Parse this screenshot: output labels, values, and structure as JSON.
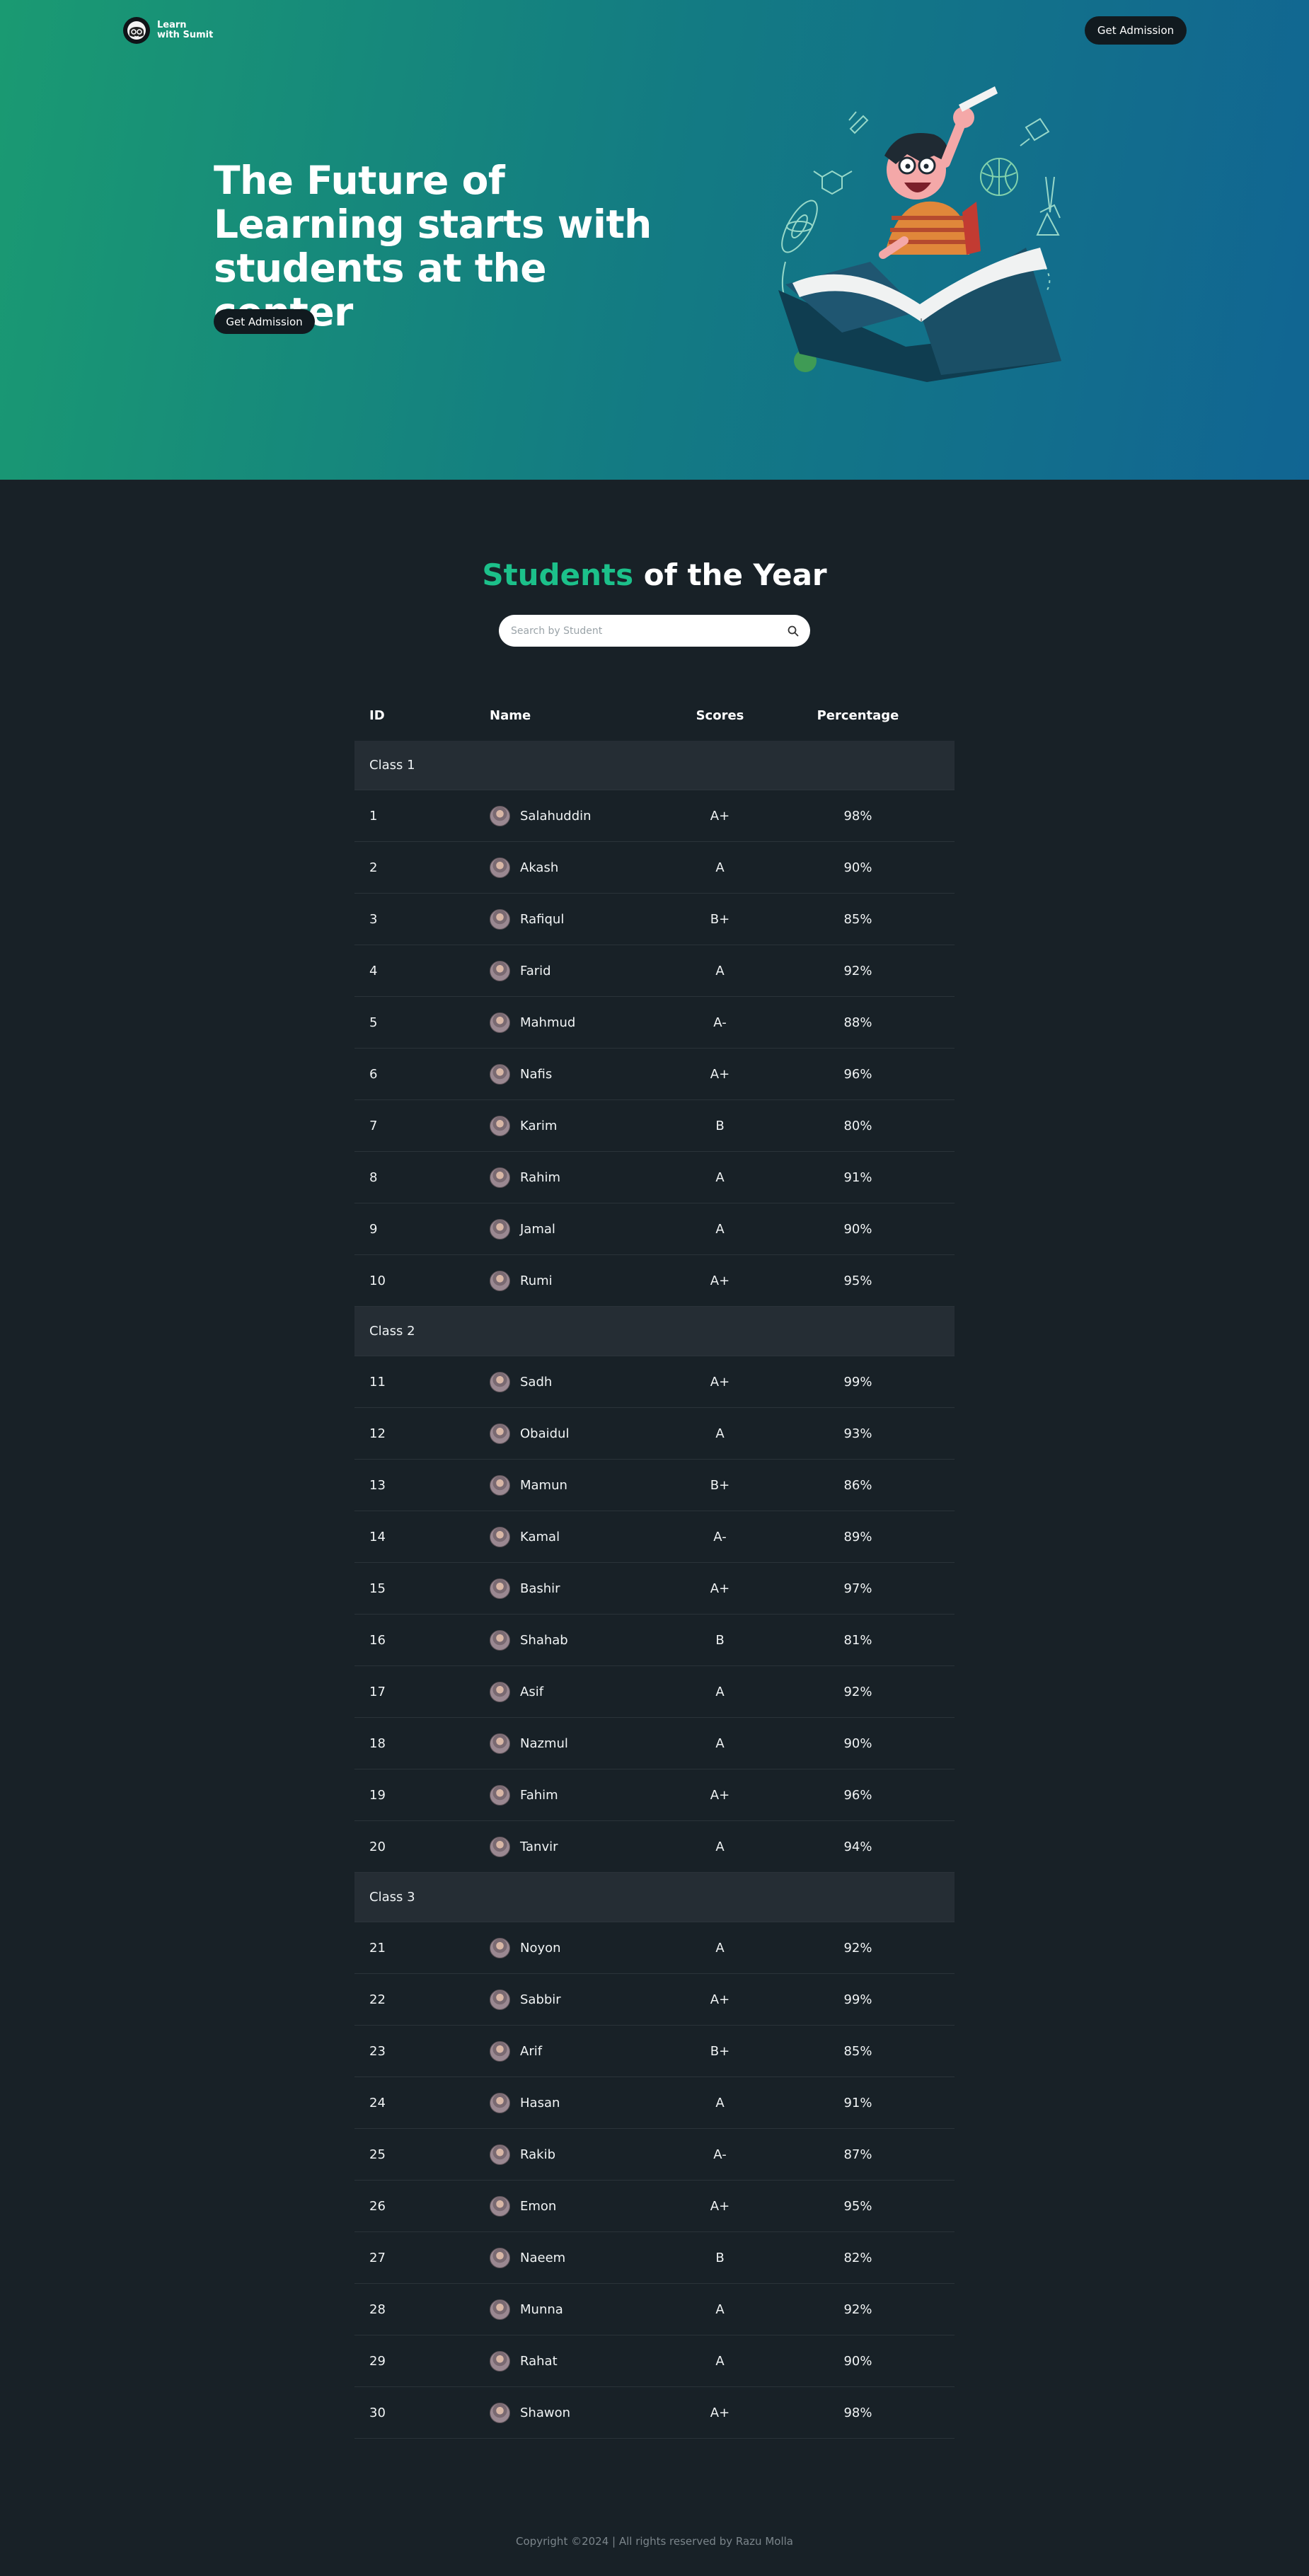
{
  "brand": {
    "line1": "Learn",
    "line2": "with Sumit"
  },
  "nav": {
    "cta_label": "Get Admission"
  },
  "hero": {
    "title": "The Future of Learning starts with students at the center",
    "cta_label": "Get Admission"
  },
  "section": {
    "title_accent": "Students",
    "title_rest": " of the Year"
  },
  "search": {
    "placeholder": "Search by Student",
    "value": ""
  },
  "table": {
    "headers": {
      "id": "ID",
      "name": "Name",
      "scores": "Scores",
      "percentage": "Percentage"
    },
    "groups": [
      {
        "label": "Class 1",
        "rows": [
          {
            "id": "1",
            "name": "Salahuddin",
            "score": "A+",
            "percentage": "98%"
          },
          {
            "id": "2",
            "name": "Akash",
            "score": "A",
            "percentage": "90%"
          },
          {
            "id": "3",
            "name": "Rafiqul",
            "score": "B+",
            "percentage": "85%"
          },
          {
            "id": "4",
            "name": "Farid",
            "score": "A",
            "percentage": "92%"
          },
          {
            "id": "5",
            "name": "Mahmud",
            "score": "A-",
            "percentage": "88%"
          },
          {
            "id": "6",
            "name": "Nafis",
            "score": "A+",
            "percentage": "96%"
          },
          {
            "id": "7",
            "name": "Karim",
            "score": "B",
            "percentage": "80%"
          },
          {
            "id": "8",
            "name": "Rahim",
            "score": "A",
            "percentage": "91%"
          },
          {
            "id": "9",
            "name": "Jamal",
            "score": "A",
            "percentage": "90%"
          },
          {
            "id": "10",
            "name": "Rumi",
            "score": "A+",
            "percentage": "95%"
          }
        ]
      },
      {
        "label": "Class 2",
        "rows": [
          {
            "id": "11",
            "name": "Sadh",
            "score": "A+",
            "percentage": "99%"
          },
          {
            "id": "12",
            "name": "Obaidul",
            "score": "A",
            "percentage": "93%"
          },
          {
            "id": "13",
            "name": "Mamun",
            "score": "B+",
            "percentage": "86%"
          },
          {
            "id": "14",
            "name": "Kamal",
            "score": "A-",
            "percentage": "89%"
          },
          {
            "id": "15",
            "name": "Bashir",
            "score": "A+",
            "percentage": "97%"
          },
          {
            "id": "16",
            "name": "Shahab",
            "score": "B",
            "percentage": "81%"
          },
          {
            "id": "17",
            "name": "Asif",
            "score": "A",
            "percentage": "92%"
          },
          {
            "id": "18",
            "name": "Nazmul",
            "score": "A",
            "percentage": "90%"
          },
          {
            "id": "19",
            "name": "Fahim",
            "score": "A+",
            "percentage": "96%"
          },
          {
            "id": "20",
            "name": "Tanvir",
            "score": "A",
            "percentage": "94%"
          }
        ]
      },
      {
        "label": "Class 3",
        "rows": [
          {
            "id": "21",
            "name": "Noyon",
            "score": "A",
            "percentage": "92%"
          },
          {
            "id": "22",
            "name": "Sabbir",
            "score": "A+",
            "percentage": "99%"
          },
          {
            "id": "23",
            "name": "Arif",
            "score": "B+",
            "percentage": "85%"
          },
          {
            "id": "24",
            "name": "Hasan",
            "score": "A",
            "percentage": "91%"
          },
          {
            "id": "25",
            "name": "Rakib",
            "score": "A-",
            "percentage": "87%"
          },
          {
            "id": "26",
            "name": "Emon",
            "score": "A+",
            "percentage": "95%"
          },
          {
            "id": "27",
            "name": "Naeem",
            "score": "B",
            "percentage": "82%"
          },
          {
            "id": "28",
            "name": "Munna",
            "score": "A",
            "percentage": "92%"
          },
          {
            "id": "29",
            "name": "Rahat",
            "score": "A",
            "percentage": "90%"
          },
          {
            "id": "30",
            "name": "Shawon",
            "score": "A+",
            "percentage": "98%"
          }
        ]
      }
    ]
  },
  "footer": {
    "text": "Copyright ©2024 | All rights reserved by Razu Molla"
  },
  "colors": {
    "accent": "#1cc08a",
    "background": "#182127",
    "button": "#111a1f"
  }
}
